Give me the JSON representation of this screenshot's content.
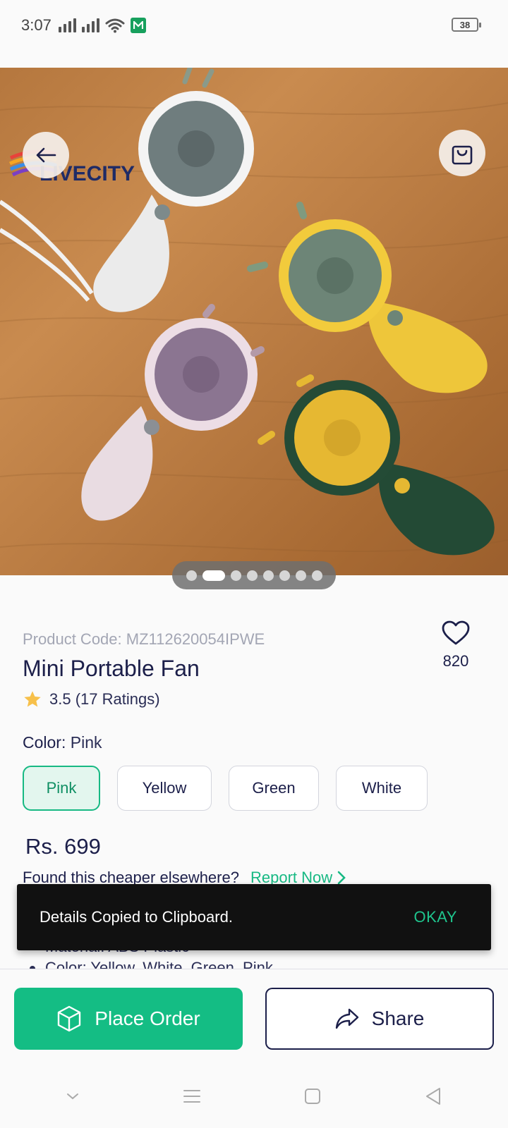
{
  "status_bar": {
    "time": "3:07",
    "battery": "38"
  },
  "hero": {
    "brand_text": "LIVECITY",
    "slides_total": 8,
    "active_slide": 2
  },
  "product": {
    "code": "Product Code: MZ112620054IPWE",
    "title": "Mini Portable Fan",
    "rating_text": "3.5 (17 Ratings)",
    "favorites_count": "820",
    "color_label": "Color:",
    "color_value": "Pink",
    "color_options": [
      "Pink",
      "Yellow",
      "Green",
      "White"
    ],
    "selected_color": "Pink",
    "price": "Rs. 699",
    "cheaper_text": "Found this cheaper elsewhere?",
    "report_link": "Report Now",
    "bullets": [
      "Material: ABS Plastic",
      "Color: Yellow, White, Green, Pink"
    ]
  },
  "snackbar": {
    "message": "Details Copied to Clipboard.",
    "action": "OKAY"
  },
  "actions": {
    "place_order": "Place Order",
    "share": "Share"
  },
  "colors": {
    "primary_green": "#14bd84",
    "navy": "#1c1f4a",
    "snackbar_bg": "#111111"
  },
  "icons": {
    "back": "arrow-left-icon",
    "bag": "shopping-bag-icon",
    "heart": "heart-icon",
    "star": "star-icon",
    "box": "box-icon",
    "share": "share-arrow-icon"
  }
}
